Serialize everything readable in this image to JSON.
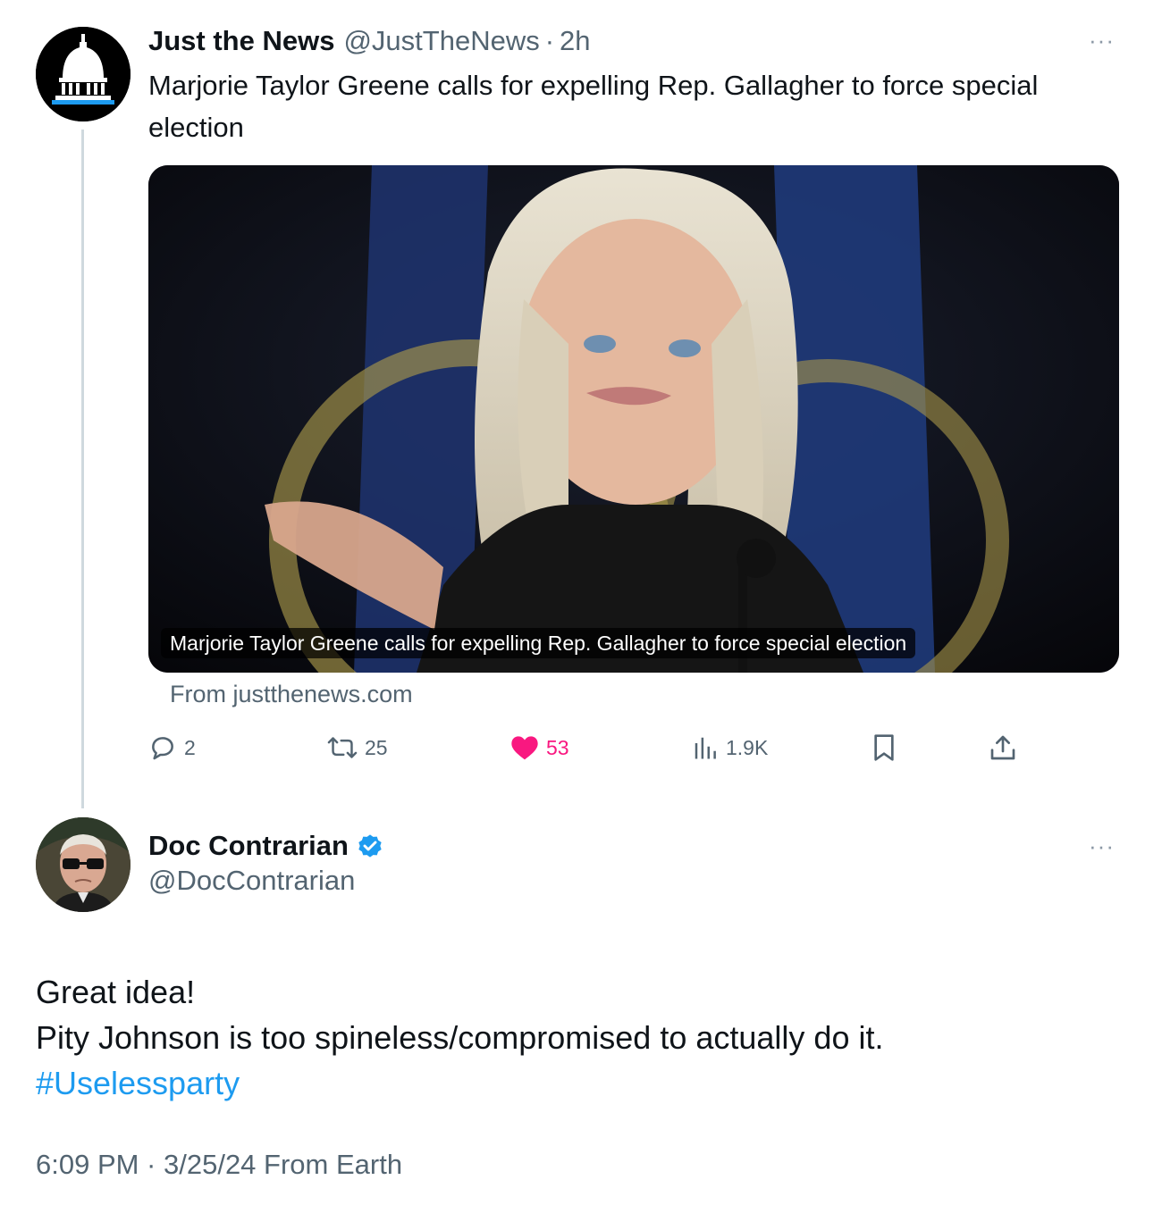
{
  "parent_tweet": {
    "display_name": "Just the News",
    "handle": "@JustTheNews",
    "separator": "·",
    "time": "2h",
    "more_label": "···",
    "text": "Marjorie Taylor Greene calls for expelling Rep. Gallagher to force special election",
    "card": {
      "caption": "Marjorie Taylor Greene calls for expelling Rep. Gallagher to force special election",
      "source": "From justthenews.com"
    },
    "actions": {
      "replies": "2",
      "reposts": "25",
      "likes": "53",
      "views": "1.9K"
    }
  },
  "reply": {
    "display_name": "Doc Contrarian",
    "handle": "@DocContrarian",
    "more_label": "···",
    "lines": [
      "Great idea!",
      "Pity Johnson is too spineless/compromised to actually do it."
    ],
    "hashtag": "#Uselessparty",
    "timestamp": "6:09 PM · 3/25/24 From Earth"
  },
  "colors": {
    "text": "#0f1419",
    "secondary": "#536471",
    "link": "#1d9bf0",
    "like": "#f91880",
    "thread_line": "#cfd9de"
  },
  "icons": {
    "jtn_avatar": "capitol-dome-icon",
    "reply": "speech-bubble-icon",
    "repost": "repost-icon",
    "like": "heart-icon",
    "views": "bar-chart-icon",
    "bookmark": "bookmark-icon",
    "share": "share-icon",
    "verified": "verified-badge-icon"
  }
}
